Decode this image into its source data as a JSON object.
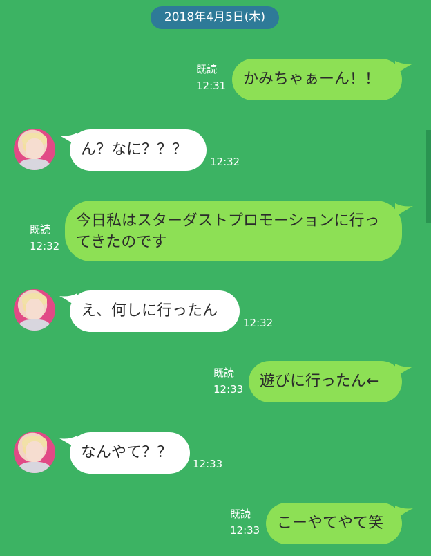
{
  "date_label": "2018年4月5日(木)",
  "messages": [
    {
      "side": "out",
      "text": "かみちゃぁーん！！",
      "read": "既読",
      "time": "12:31"
    },
    {
      "side": "in",
      "text": "ん？なに？？？",
      "time": "12:32"
    },
    {
      "side": "out",
      "text": "今日私はスターダストプロモーションに行ってきたのです",
      "read": "既読",
      "time": "12:32"
    },
    {
      "side": "in",
      "text": "え、何しに行ったん",
      "time": "12:32"
    },
    {
      "side": "out",
      "text": "遊びに行ったん←",
      "read": "既読",
      "time": "12:33"
    },
    {
      "side": "in",
      "text": "なんやて？？",
      "time": "12:33"
    },
    {
      "side": "out",
      "text": "こーやてやて笑",
      "read": "既読",
      "time": "12:33"
    }
  ],
  "colors": {
    "background": "#3cb363",
    "outgoing_bubble": "#8de055",
    "incoming_bubble": "#ffffff",
    "date_pill": "#2e7a98"
  },
  "icons": {
    "avatar": "user-avatar-photo"
  }
}
